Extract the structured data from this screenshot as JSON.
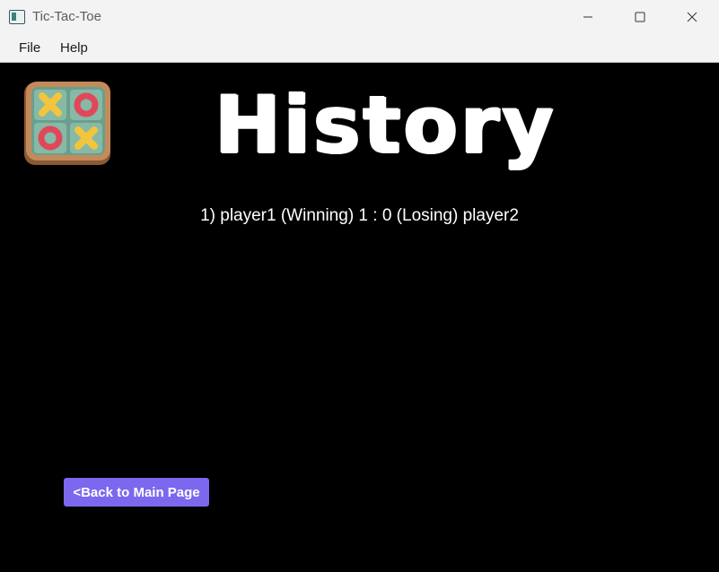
{
  "window": {
    "title": "Tic-Tac-Toe",
    "controls": {
      "minimize": "minimize-icon",
      "maximize": "maximize-icon",
      "close": "close-icon"
    }
  },
  "menu": {
    "items": [
      "File",
      "Help"
    ]
  },
  "page": {
    "heading": "History",
    "logo": "tic-tac-toe-board-icon",
    "history": [
      "1) player1 (Winning) 1 : 0 (Losing) player2"
    ],
    "back_button": "<Back to Main Page"
  },
  "colors": {
    "background": "#000000",
    "button": "#7b68ee",
    "titlebar": "#f3f3f3",
    "logo_x": "#f2c53d",
    "logo_o": "#e0485a"
  }
}
